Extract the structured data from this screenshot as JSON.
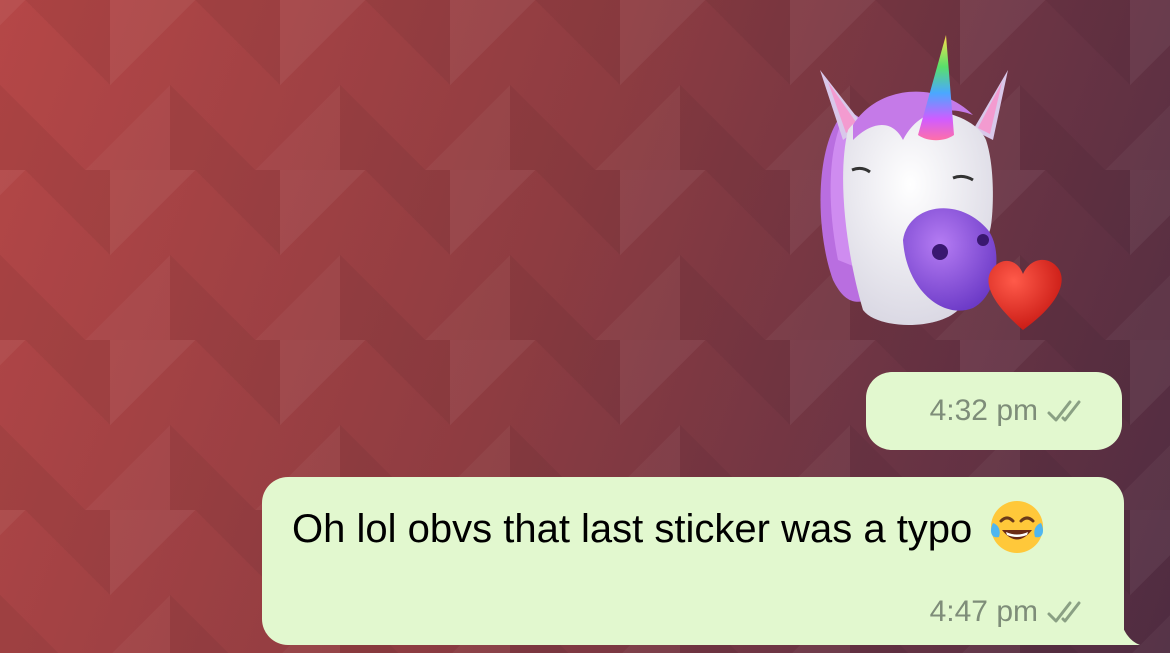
{
  "messages": [
    {
      "type": "sticker",
      "sticker_icon": "unicorn-kiss-heart-icon",
      "time": "4:32 pm",
      "status_icon": "double-check-icon"
    },
    {
      "type": "text",
      "text": "Oh lol obvs that last sticker was  a typo",
      "emoji_icon": "face-with-tears-of-joy-icon",
      "time": "4:47 pm",
      "status_icon": "double-check-icon"
    }
  ],
  "colors": {
    "bubble": "#e2f8cf",
    "meta_text": "#7e8d79",
    "background_left": "#b54747",
    "background_right": "#4f2c41"
  }
}
